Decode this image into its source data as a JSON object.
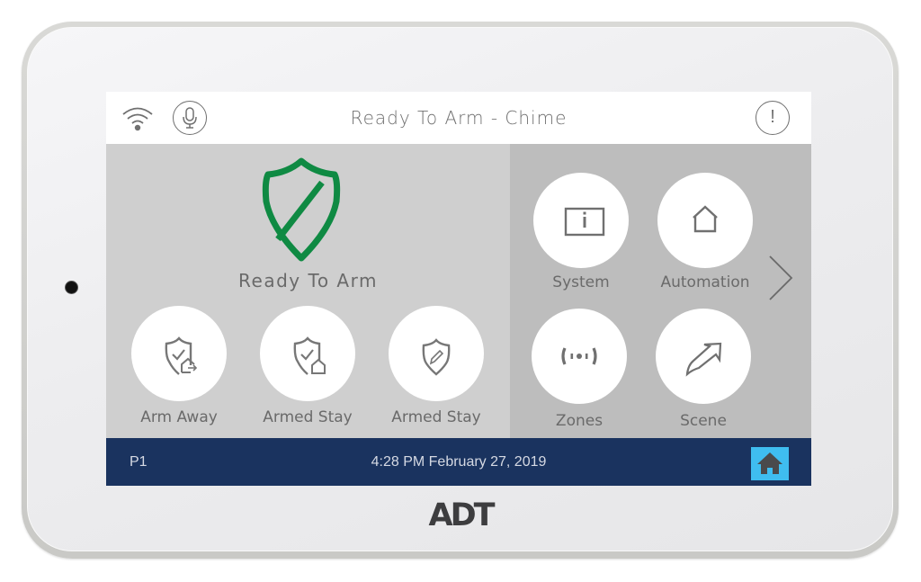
{
  "status_bar": {
    "title": "Ready To Arm - Chime",
    "icons": [
      "wifi-icon",
      "microphone-icon",
      "alert-icon"
    ],
    "alert_glyph": "!"
  },
  "security": {
    "status_label": "Ready To Arm",
    "status_icon": "shield-slash-icon",
    "status_color": "#0f8a43",
    "arm_buttons": [
      {
        "label": "Arm Away",
        "icon": "shield-check-away-icon"
      },
      {
        "label": "Armed Stay",
        "icon": "shield-check-home-icon"
      },
      {
        "label": "Armed Stay",
        "icon": "shield-pencil-icon"
      }
    ]
  },
  "menu": {
    "items": [
      {
        "label": "System",
        "icon": "info-panel-icon"
      },
      {
        "label": "Automation",
        "icon": "house-outline-icon"
      },
      {
        "label": "Zones",
        "icon": "sensor-signal-icon"
      },
      {
        "label": "Scene",
        "icon": "arrow-up-right-icon"
      }
    ],
    "next_icon": "chevron-right-icon"
  },
  "footer": {
    "partition": "P1",
    "datetime": "4:28 PM February 27, 2019",
    "home_icon": "home-icon",
    "background": "#1a335f",
    "home_button_color": "#3fbdf0"
  },
  "device": {
    "brand": "ADT"
  }
}
